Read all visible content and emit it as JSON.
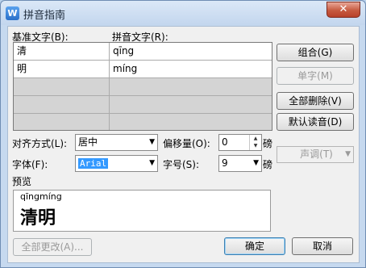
{
  "window": {
    "title": "拼音指南",
    "app_icon_letter": "W",
    "close_glyph": "✕"
  },
  "table": {
    "base_header": "基准文字(B):",
    "pinyin_header": "拼音文字(R):",
    "rows": [
      {
        "base": "清",
        "pinyin": "qīng"
      },
      {
        "base": "明",
        "pinyin": "míng"
      },
      {
        "base": "",
        "pinyin": ""
      },
      {
        "base": "",
        "pinyin": ""
      },
      {
        "base": "",
        "pinyin": ""
      }
    ]
  },
  "buttons": {
    "combine": "组合(G)",
    "single_char": "单字(M)",
    "delete_all": "全部删除(V)",
    "default_reading": "默认读音(D)",
    "tone": "声调(T)",
    "change_all": "全部更改(A)...",
    "ok": "确定",
    "cancel": "取消"
  },
  "options": {
    "alignment_label": "对齐方式(L):",
    "alignment_value": "居中",
    "offset_label": "偏移量(O):",
    "offset_value": "0",
    "offset_unit": "磅",
    "font_label": "字体(F):",
    "font_value": "Arial",
    "size_label": "字号(S):",
    "size_value": "9",
    "size_unit": "磅"
  },
  "preview": {
    "label": "预览",
    "pinyin": "qīngmíng",
    "text": "清明"
  },
  "icons": {
    "dropdown": "▼",
    "spin_up": "▲",
    "spin_down": "▼"
  }
}
